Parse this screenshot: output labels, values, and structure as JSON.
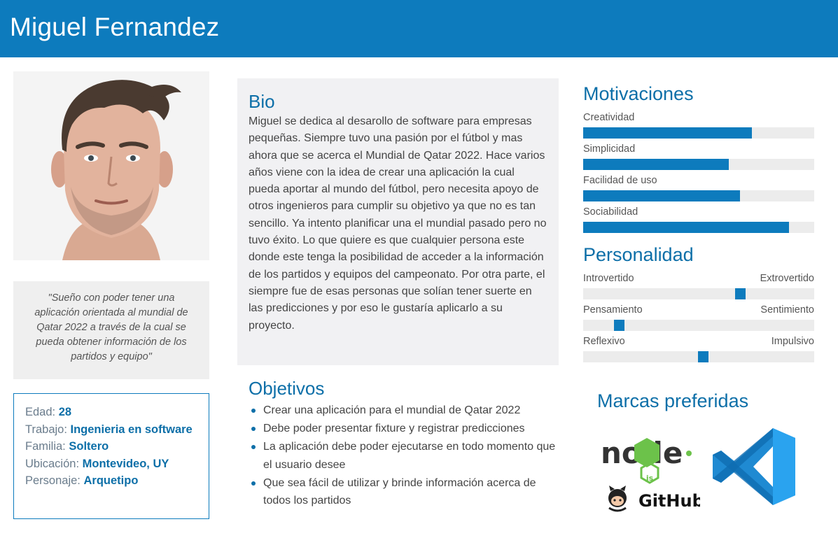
{
  "persona": {
    "name": "Miguel Fernandez",
    "quote": "\"Sueño con poder tener una aplicación orientada al mundial de Qatar 2022 a través de la cual se pueda obtener información de los partidos y equipo\""
  },
  "info": {
    "rows": [
      {
        "label": "Edad:",
        "value": "28"
      },
      {
        "label": "Trabajo:",
        "value": "Ingenieria en software"
      },
      {
        "label": "Familia:",
        "value": "Soltero"
      },
      {
        "label": "Ubicación:",
        "value": "Montevideo, UY"
      },
      {
        "label": "Personaje:",
        "value": "Arquetipo"
      }
    ]
  },
  "bio": {
    "title": "Bio",
    "text": "Miguel se dedica al desarollo de software para empresas pequeñas. Siempre tuvo una pasión por el fútbol y mas ahora que se acerca el Mundial de Qatar 2022. Hace varios años viene con la idea de crear una aplicación la cual pueda aportar al mundo del fútbol, pero necesita apoyo de otros ingenieros para cumplir su objetivo ya que no es tan sencillo. Ya intento planificar una el mundial pasado pero no tuvo éxito. Lo que quiere es que cualquier persona este donde este tenga la posibilidad de acceder a la información de los partidos y equipos del campeonato. Por otra parte, el siempre fue de esas personas que solían tener suerte en las predicciones y por eso le gustaría aplicarlo a su proyecto."
  },
  "objetivos": {
    "title": "Objetivos",
    "items": [
      "Crear una aplicación para el mundial de Qatar 2022",
      "Debe poder presentar fixture y registrar predicciones",
      "La aplicación debe poder ejecutarse en todo momento que el usuario desee",
      "Que sea fácil de utilizar y brinde información acerca de todos los partidos"
    ]
  },
  "motivaciones": {
    "title": "Motivaciones",
    "items": [
      {
        "label": "Creatividad",
        "level": 0.73
      },
      {
        "label": "Simplicidad",
        "level": 0.63
      },
      {
        "label": "Facilidad de uso",
        "level": 0.68
      },
      {
        "label": "Sociabilidad",
        "level": 0.89
      }
    ]
  },
  "personalidad": {
    "title": "Personalidad",
    "items": [
      {
        "left": "Introvertido",
        "right": "Extrovertido",
        "level": 0.69
      },
      {
        "left": "Pensamiento",
        "right": "Sentimiento",
        "level": 0.14
      },
      {
        "left": "Reflexivo",
        "right": "Impulsivo",
        "level": 0.52
      }
    ]
  },
  "marcas": {
    "title": "Marcas preferidas",
    "logos": [
      "node",
      "js",
      "GitHub"
    ],
    "icons": [
      "nodejs-logo-icon",
      "github-logo-icon",
      "vscode-logo-icon"
    ]
  },
  "colors": {
    "accent": "#0d7bbd",
    "heading": "#0d6fa8",
    "panel": "#f1f1f3",
    "track": "#ececec"
  }
}
